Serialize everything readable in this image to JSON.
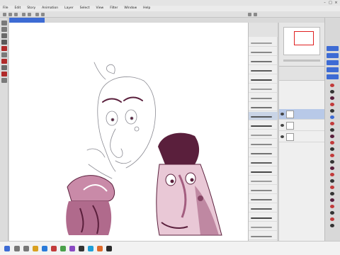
{
  "window": {
    "title": "",
    "controls": [
      "–",
      "□",
      "×"
    ]
  },
  "menu": {
    "items": [
      "File",
      "Edit",
      "Story",
      "Animation",
      "Layer",
      "Select",
      "View",
      "Filter",
      "Window",
      "Help"
    ]
  },
  "document": {
    "tab_label": ""
  },
  "brush_panel": {
    "items": [
      {
        "label": ""
      },
      {
        "label": ""
      },
      {
        "label": ""
      },
      {
        "label": ""
      },
      {
        "label": ""
      },
      {
        "label": ""
      },
      {
        "label": ""
      },
      {
        "label": ""
      },
      {
        "label": ""
      },
      {
        "label": ""
      },
      {
        "label": ""
      },
      {
        "label": ""
      },
      {
        "label": ""
      },
      {
        "label": ""
      },
      {
        "label": ""
      },
      {
        "label": ""
      },
      {
        "label": ""
      },
      {
        "label": ""
      },
      {
        "label": ""
      },
      {
        "label": ""
      },
      {
        "label": ""
      },
      {
        "label": ""
      }
    ],
    "selected_index": 8
  },
  "layers": [
    {
      "name": ""
    },
    {
      "name": ""
    },
    {
      "name": ""
    }
  ],
  "clock": {
    "time": "",
    "date": ""
  },
  "colors": {
    "accent": "#3d6bd4",
    "sketch_line": "#8a8a92",
    "ink": "#5a1f3c",
    "shade": "#a35d7f"
  },
  "tool_icons": [
    "move-icon",
    "zoom-icon",
    "eyedropper-icon",
    "pen-icon",
    "brush-icon",
    "eraser-icon",
    "fill-icon",
    "text-icon",
    "selection-icon",
    "color-icon"
  ]
}
